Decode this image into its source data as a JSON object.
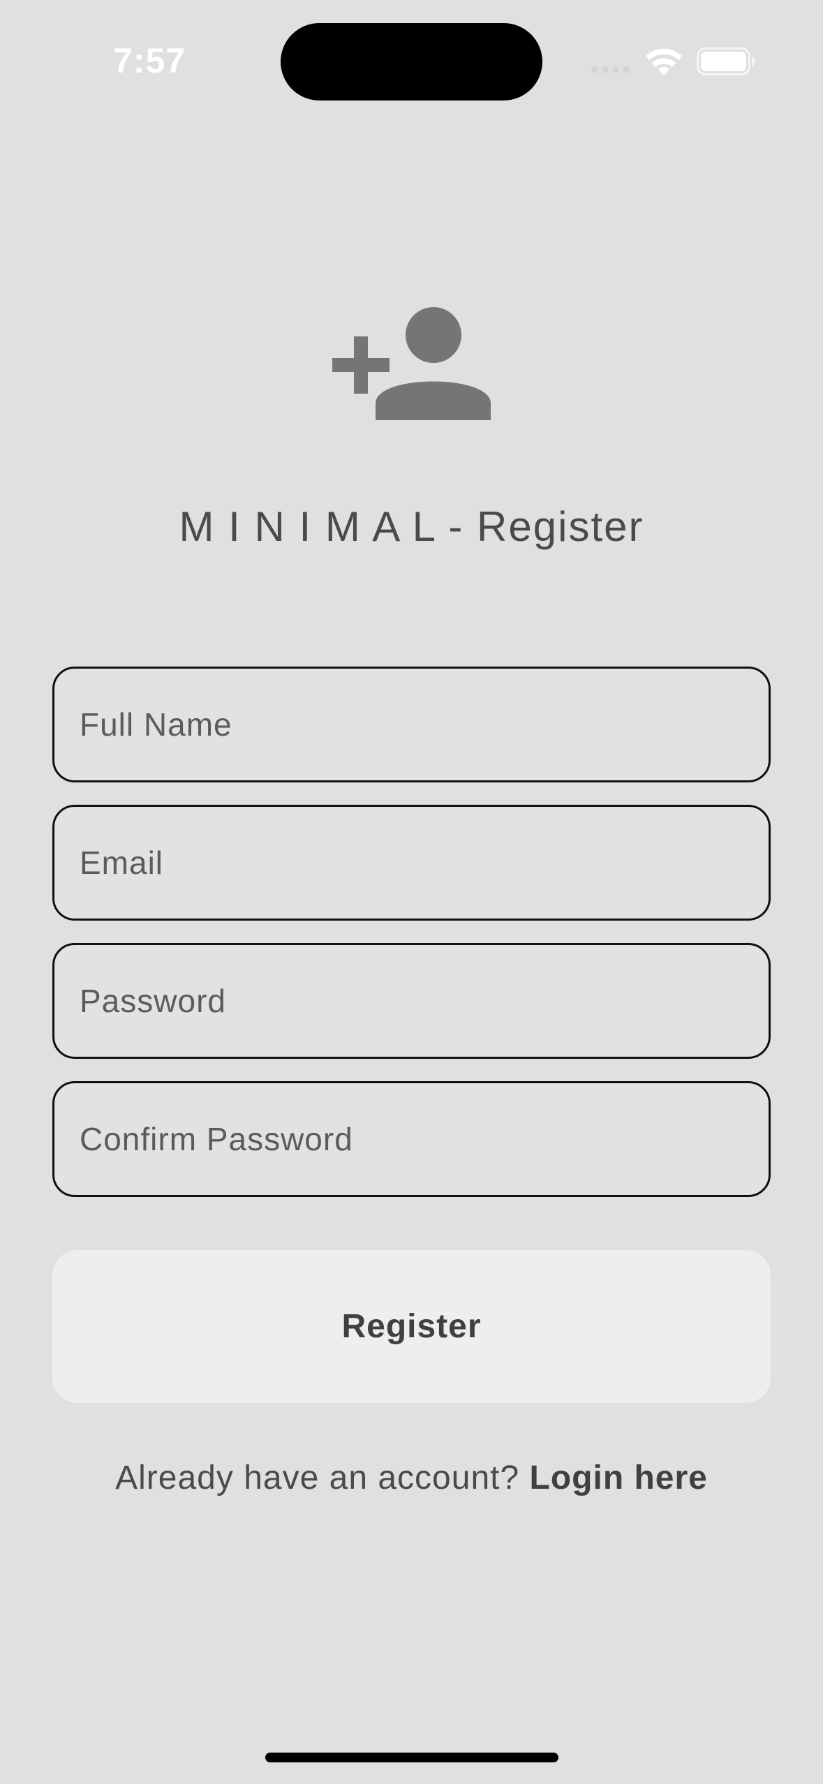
{
  "status_bar": {
    "time": "7:57",
    "icons": [
      "signal-icon",
      "wifi-icon",
      "battery-icon"
    ]
  },
  "header": {
    "icon": "person-add-icon",
    "title": "M I N I M A L - Register"
  },
  "form": {
    "full_name": {
      "placeholder": "Full Name",
      "value": ""
    },
    "email": {
      "placeholder": "Email",
      "value": ""
    },
    "password": {
      "placeholder": "Password",
      "value": ""
    },
    "confirm_password": {
      "placeholder": "Confirm Password",
      "value": ""
    }
  },
  "register_button": {
    "label": "Register"
  },
  "login_prompt": {
    "text": "Already have an account? ",
    "link_label": "Login here"
  },
  "colors": {
    "background": "#e0e0e0",
    "button_background": "#eeeeee",
    "icon": "#757575",
    "text": "#4a4a4a"
  }
}
